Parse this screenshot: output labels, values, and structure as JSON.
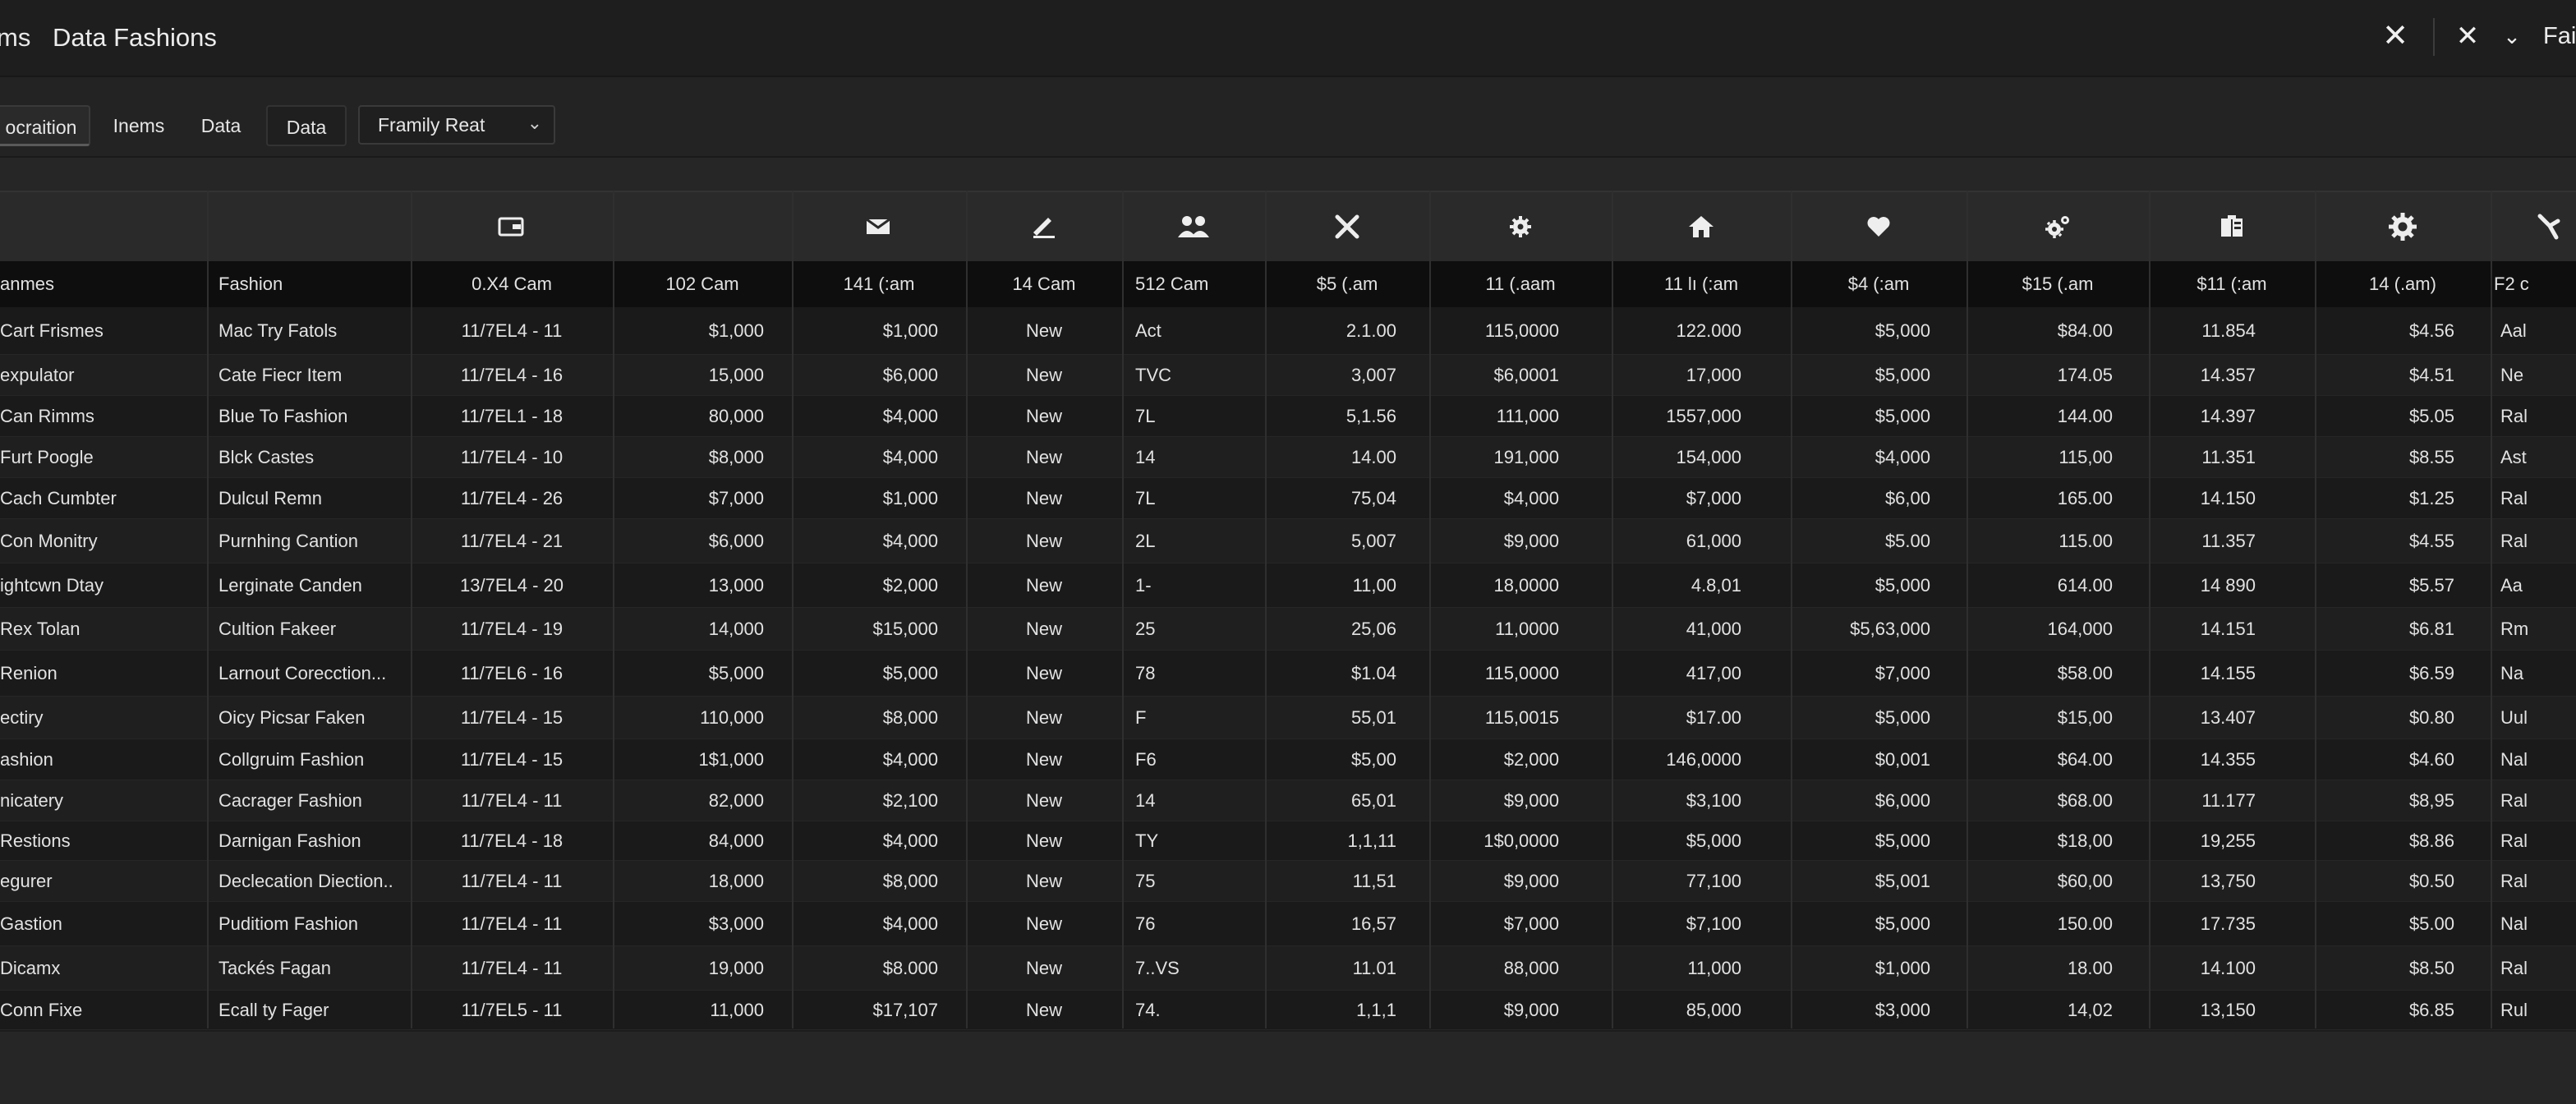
{
  "window": {
    "breadcrumb_prev": "ms",
    "title": "Data Fashions",
    "right_label": "Fai"
  },
  "toolbar": {
    "tabs": [
      {
        "label": "ocraition",
        "active": true
      },
      {
        "label": "Inems",
        "active": false
      },
      {
        "label": "Data",
        "active": false
      },
      {
        "label": "Data",
        "active": false
      }
    ],
    "select": {
      "value": "Framily Reat"
    }
  },
  "icons": {
    "window_close": "close-icon",
    "window_close_secondary": "close-icon",
    "window_menu": "chevron-down-icon",
    "select_chevron": "chevron-down-icon",
    "column_icons": [
      "card-icon",
      "moon-icon",
      "mail-icon",
      "pen-icon",
      "users-icon",
      "x-icon",
      "gear-icon",
      "home-icon",
      "heart-icon",
      "gears-icon",
      "document-icon",
      "settings-icon",
      "tool-icon"
    ]
  },
  "table": {
    "headers": [
      "anmes",
      "Fashion",
      "0.X4 Cam",
      "102 Cam",
      "141 (:am",
      "14 Cam",
      "512 Cam",
      "$5 (.am",
      "11 (.aam",
      "11 lı (:am",
      "$4 (:am",
      "$15 (.am",
      "$11 (:am",
      "14 (.am)",
      "F2 c"
    ],
    "rows": [
      [
        "Cart Frismes",
        "Mac Try Fatols",
        "11/7EL4 - 11",
        "$1,000",
        "$1,000",
        "New",
        "Act",
        "2.1.00",
        "115,0000",
        "122.000",
        "$5,000",
        "$84.00",
        "11.854",
        "$4.56",
        "Aal"
      ],
      [
        "expulator",
        "Cate Fiecr Item",
        "11/7EL4 - 16",
        "15,000",
        "$6,000",
        "New",
        "TVC",
        "3,007",
        "$6,0001",
        "17,000",
        "$5,000",
        "174.05",
        "14.357",
        "$4.51",
        "Ne"
      ],
      [
        "Can Rimms",
        "Blue To Fashion",
        "11/7EL1 - 18",
        "80,000",
        "$4,000",
        "New",
        "7L",
        "5,1.56",
        "111,000",
        "1557,000",
        "$5,000",
        "144.00",
        "14.397",
        "$5.05",
        "Ral"
      ],
      [
        "Furt Poogle",
        "Blck Castes",
        "11/7EL4 - 10",
        "$8,000",
        "$4,000",
        "New",
        "14",
        "14.00",
        "191,000",
        "154,000",
        "$4,000",
        "115,00",
        "11.351",
        "$8.55",
        "Ast"
      ],
      [
        "Cach Cumbter",
        "Dulcul Remn",
        "11/7EL4 - 26",
        "$7,000",
        "$1,000",
        "New",
        "7L",
        "75,04",
        "$4,000",
        "$7,000",
        "$6,00",
        "165.00",
        "14.150",
        "$1.25",
        "Ral"
      ],
      [
        "Con Monitry",
        "Purnhing Cantion",
        "11/7EL4 - 21",
        "$6,000",
        "$4,000",
        "New",
        "2L",
        "5,007",
        "$9,000",
        "61,000",
        "$5.00",
        "115.00",
        "11.357",
        "$4.55",
        "Ral"
      ],
      [
        "ightcwn Dtay",
        "Lerginate Canden",
        "13/7EL4 - 20",
        "13,000",
        "$2,000",
        "New",
        "1-",
        "11,00",
        "18,0000",
        "4.8,01",
        "$5,000",
        "614.00",
        "14 890",
        "$5.57",
        "Aa"
      ],
      [
        "Rex Tolan",
        "Cultion Fakeer",
        "11/7EL4 - 19",
        "14,000",
        "$15,000",
        "New",
        "25",
        "25,06",
        "11,0000",
        "41,000",
        "$5,63,000",
        "164,000",
        "14.151",
        "$6.81",
        "Rm"
      ],
      [
        "Renion",
        "Larnout Corecction...",
        "11/7EL6 - 16",
        "$5,000",
        "$5,000",
        "New",
        "78",
        "$1.04",
        "115,0000",
        "417,00",
        "$7,000",
        "$58.00",
        "14.155",
        "$6.59",
        "Na"
      ],
      [
        "ectiry",
        "Oicy Picsar Faken",
        "11/7EL4 - 15",
        "110,000",
        "$8,000",
        "New",
        "F",
        "55,01",
        "115,0015",
        "$17.00",
        "$5,000",
        "$15,00",
        "13.407",
        "$0.80",
        "Uul"
      ],
      [
        "ashion",
        "Collgruim Fashion",
        "11/7EL4 - 15",
        "1$1,000",
        "$4,000",
        "New",
        "F6",
        "$5,00",
        "$2,000",
        "146,0000",
        "$0,001",
        "$64.00",
        "14.355",
        "$4.60",
        "Nal"
      ],
      [
        "nicatery",
        "Cacrager Fashion",
        "11/7EL4 - 11",
        "82,000",
        "$2,100",
        "New",
        "14",
        "65,01",
        "$9,000",
        "$3,100",
        "$6,000",
        "$68.00",
        "11.177",
        "$8,95",
        "Ral"
      ],
      [
        "Restions",
        "Darnigan Fashion",
        "11/7EL4 - 18",
        "84,000",
        "$4,000",
        "New",
        "TY",
        "1,1,11",
        "1$0,0000",
        "$5,000",
        "$5,000",
        "$18,00",
        "19,255",
        "$8.86",
        "Ral"
      ],
      [
        "egurer",
        "Declecation Diection..",
        "11/7EL4 - 11",
        "18,000",
        "$8,000",
        "New",
        "75",
        "11,51",
        "$9,000",
        "77,100",
        "$5,001",
        "$60,00",
        "13,750",
        "$0.50",
        "Ral"
      ],
      [
        "Gastion",
        "Puditiom Fashion",
        "11/7EL4 - 11",
        "$3,000",
        "$4,000",
        "New",
        "76",
        "16,57",
        "$7,000",
        "$7,100",
        "$5,000",
        "150.00",
        "17.735",
        "$5.00",
        "Nal"
      ],
      [
        "Dicamx",
        "Tackés Fagan",
        "11/7EL4 - 11",
        "19,000",
        "$8.000",
        "New",
        "7..VS",
        "11.01",
        "88,000",
        "11,000",
        "$1,000",
        "18.00",
        "14.100",
        "$8.50",
        "Ral"
      ],
      [
        "Conn Fixe",
        "Ecall ty Fager",
        "11/7EL5 - 11",
        "11,000",
        "$17,107",
        "New",
        "74.",
        "1,1,1",
        "$9,000",
        "85,000",
        "$3,000",
        "14,02",
        "13,150",
        "$6.85",
        "Rul"
      ]
    ]
  }
}
